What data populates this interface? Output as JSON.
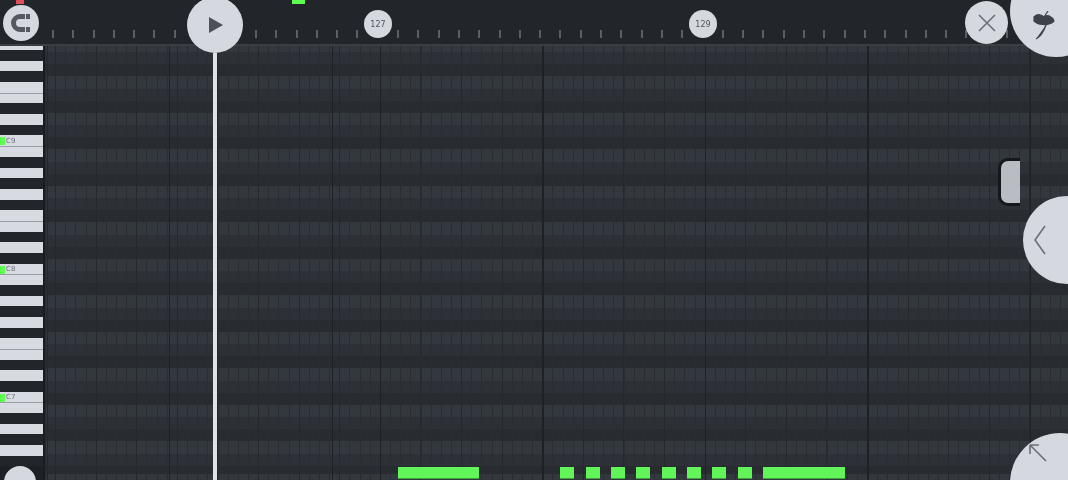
{
  "ruler": {
    "bar_markers": [
      "127",
      "129"
    ]
  },
  "keyboard": {
    "octave_labels": [
      "C9",
      "C8",
      "C7"
    ]
  }
}
